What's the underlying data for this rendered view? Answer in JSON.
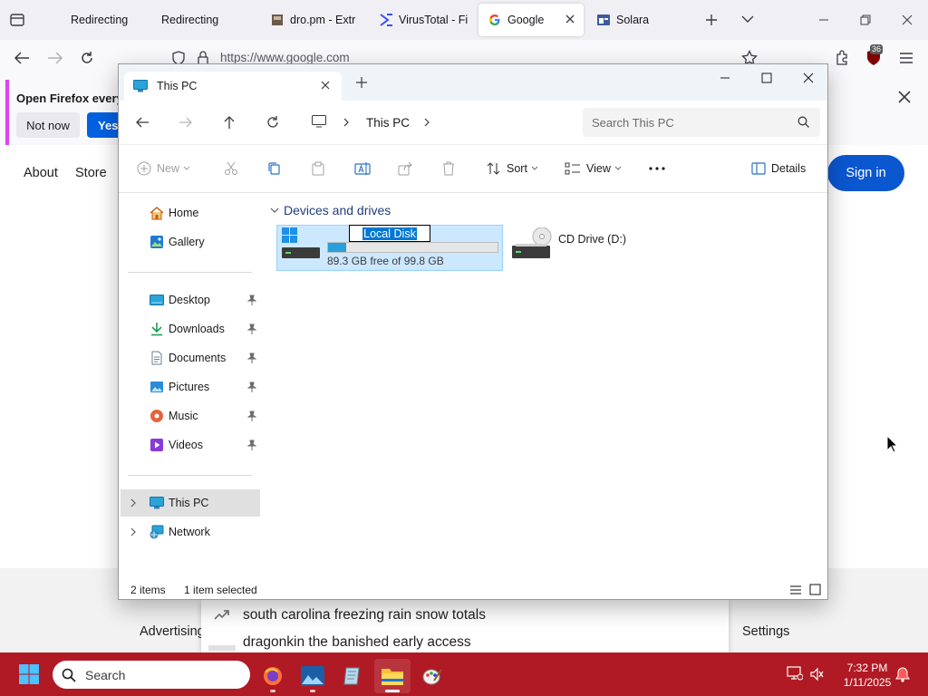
{
  "browser": {
    "tabs": [
      {
        "label": "Redirecting"
      },
      {
        "label": "Redirecting"
      },
      {
        "label": "dro.pm - Extr"
      },
      {
        "label": "VirusTotal - Fi"
      },
      {
        "label": "Google"
      },
      {
        "label": "Solara"
      }
    ],
    "url": "https://www.google.com",
    "badge_count": "36",
    "notification": {
      "title": "Open Firefox every",
      "not_now": "Not now",
      "yes": "Yes,"
    }
  },
  "google": {
    "about": "About",
    "store": "Store",
    "sign_in": "Sign in",
    "advertising": "Advertising",
    "settings": "Settings",
    "suggestions": [
      "south carolina freezing rain snow totals",
      "dragonkin the banished early access"
    ]
  },
  "explorer": {
    "tab_title": "This PC",
    "address": "This PC",
    "search_placeholder": "Search This PC",
    "commands": {
      "new": "New",
      "sort": "Sort",
      "view": "View",
      "details": "Details"
    },
    "sidebar": {
      "home": "Home",
      "gallery": "Gallery",
      "pinned": [
        "Desktop",
        "Downloads",
        "Documents",
        "Pictures",
        "Music",
        "Videos"
      ],
      "this_pc": "This PC",
      "network": "Network"
    },
    "group_title": "Devices and drives",
    "drives": [
      {
        "name": "Local Disk",
        "free_text": "89.3 GB free of 99.8 GB",
        "used_fraction": 0.105
      },
      {
        "name": "CD Drive (D:)"
      }
    ],
    "status": {
      "items": "2 items",
      "selected": "1 item selected"
    }
  },
  "taskbar": {
    "search_label": "Search",
    "time": "7:32 PM",
    "date": "1/11/2025"
  }
}
